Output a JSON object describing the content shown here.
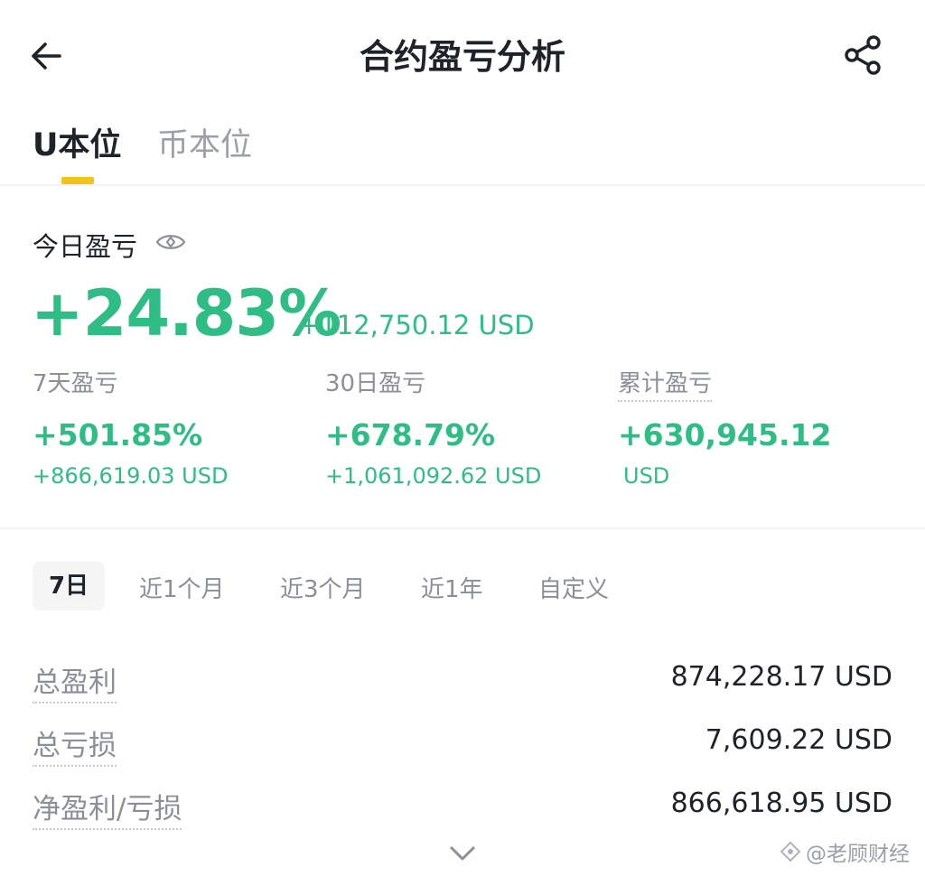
{
  "header": {
    "title": "合约盈亏分析",
    "back_icon": "arrow-left-icon",
    "share_icon": "share-icon"
  },
  "tabs": [
    {
      "label": "U本位",
      "active": true
    },
    {
      "label": "币本位",
      "active": false
    }
  ],
  "today": {
    "label": "今日盈亏",
    "eye_icon": "eye-icon",
    "percent": "+24.83%",
    "usd": "+112,750.12 USD"
  },
  "stats": [
    {
      "label": "7天盈亏",
      "percent": "+501.85%",
      "usd": "+866,619.03 USD"
    },
    {
      "label": "30日盈亏",
      "percent": "+678.79%",
      "usd": "+1,061,092.62 USD"
    },
    {
      "label": "累计盈亏",
      "percent": "+630,945.12",
      "usd": "USD"
    }
  ],
  "periods": [
    {
      "label": "7日",
      "active": true
    },
    {
      "label": "近1个月",
      "active": false
    },
    {
      "label": "近3个月",
      "active": false
    },
    {
      "label": "近1年",
      "active": false
    },
    {
      "label": "自定义",
      "active": false
    }
  ],
  "summary": [
    {
      "label": "总盈利",
      "value": "874,228.17 USD"
    },
    {
      "label": "总亏损",
      "value": "7,609.22 USD"
    },
    {
      "label": "净盈利/亏损",
      "value": "866,618.95 USD"
    }
  ],
  "expand_icon": "chevron-down-icon",
  "watermark": "@老顾财经",
  "colors": {
    "profit_green": "#2ebd85",
    "accent_yellow": "#f0c419",
    "text_primary": "#1e2329",
    "text_secondary": "#8a8f98"
  }
}
